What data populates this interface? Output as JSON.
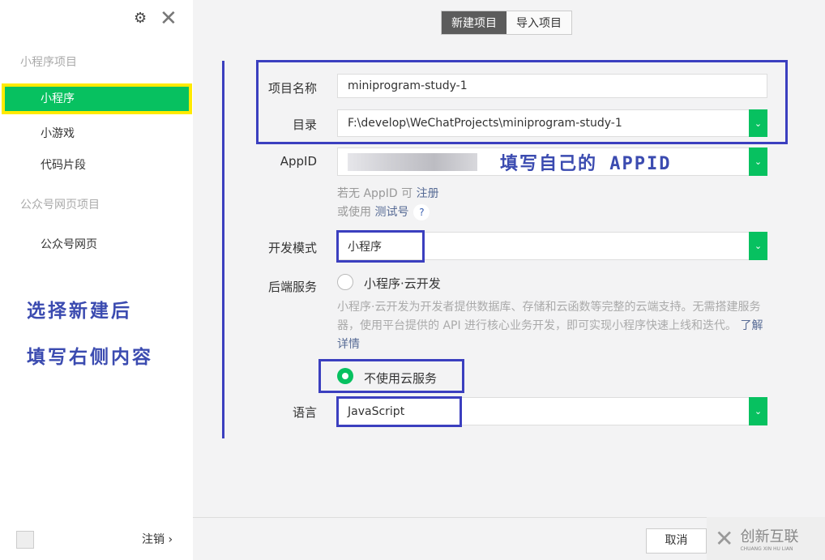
{
  "sidebar": {
    "groups": [
      "小程序项目",
      "公众号网页项目"
    ],
    "items": [
      "小程序",
      "小游戏",
      "代码片段",
      "公众号网页"
    ],
    "logout": "注销 ›"
  },
  "annotation": {
    "left_line1": "选择新建后",
    "left_line2": "填写右侧内容",
    "appid_note": "填写自己的 APPID"
  },
  "tabs": [
    "新建项目",
    "导入项目"
  ],
  "form": {
    "name_label": "项目名称",
    "name_value": "miniprogram-study-1",
    "dir_label": "目录",
    "dir_value": "F:\\develop\\WeChatProjects\\miniprogram-study-1",
    "appid_label": "AppID",
    "hint1_pre": "若无 AppID 可 ",
    "hint1_link": "注册",
    "hint2_pre": "或使用 ",
    "hint2_link": "测试号",
    "hint_q": "?",
    "mode_label": "开发模式",
    "mode_value": "小程序",
    "backend_label": "后端服务",
    "cloud_option": "小程序·云开发",
    "cloud_desc": "小程序·云开发为开发者提供数据库、存储和云函数等完整的云端支持。无需搭建服务器，使用平台提供的 API 进行核心业务开发，即可实现小程序快速上线和迭代。",
    "cloud_more": "了解详情",
    "no_cloud_option": "不使用云服务",
    "lang_label": "语言",
    "lang_value": "JavaScript"
  },
  "footer": {
    "cancel": "取消"
  },
  "watermark": {
    "text": "创新互联",
    "sub": "CHUANG XIN HU LIAN"
  },
  "colors": {
    "accent": "#07c160",
    "annotation": "#3b3fbf",
    "highlight": "#ffea00"
  }
}
